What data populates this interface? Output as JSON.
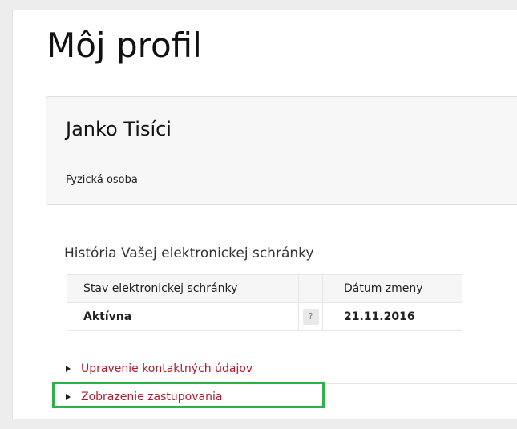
{
  "page": {
    "title": "Môj profil"
  },
  "profile": {
    "name": "Janko Tisíci",
    "type": "Fyzická osoba"
  },
  "history": {
    "title": "História Vašej elektronickej schránky",
    "columns": [
      "Stav elektronickej schránky",
      "",
      "Dátum zmeny"
    ],
    "rows": [
      {
        "state": "Aktívna",
        "help": "?",
        "date": "21.11.2016"
      }
    ]
  },
  "links": [
    {
      "label": "Upravenie kontaktných údajov",
      "icon": "triangle-right-icon"
    },
    {
      "label": "Zobrazenie zastupovania",
      "icon": "triangle-right-icon"
    }
  ],
  "colors": {
    "link": "#b4182c",
    "highlight": "#2db24a"
  }
}
